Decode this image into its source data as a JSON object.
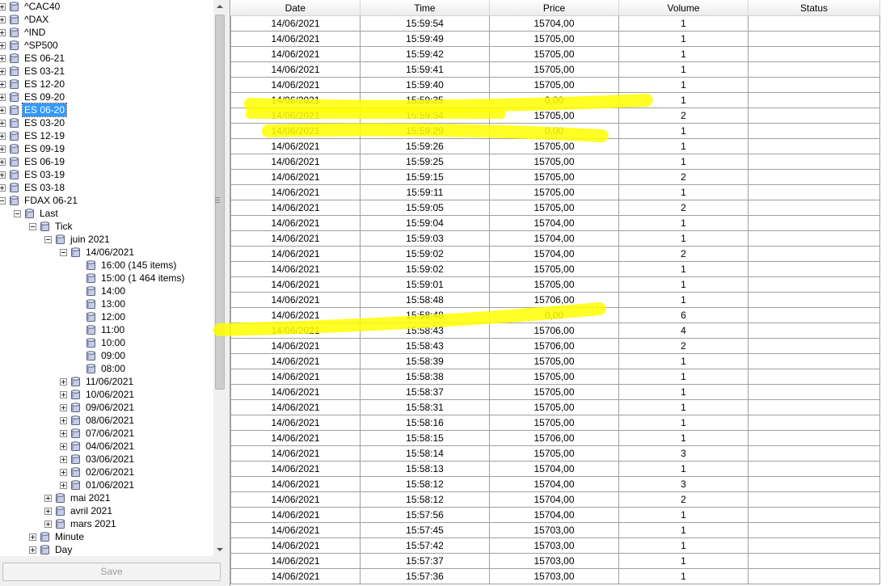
{
  "tree": {
    "nodes": [
      {
        "label": "^CAC40",
        "level": 0,
        "toggle": "plus"
      },
      {
        "label": "^DAX",
        "level": 0,
        "toggle": "plus"
      },
      {
        "label": "^IND",
        "level": 0,
        "toggle": "plus"
      },
      {
        "label": "^SP500",
        "level": 0,
        "toggle": "plus"
      },
      {
        "label": "ES 06-21",
        "level": 0,
        "toggle": "plus"
      },
      {
        "label": "ES 03-21",
        "level": 0,
        "toggle": "plus"
      },
      {
        "label": "ES 12-20",
        "level": 0,
        "toggle": "plus"
      },
      {
        "label": "ES 09-20",
        "level": 0,
        "toggle": "plus"
      },
      {
        "label": "ES 06-20",
        "level": 0,
        "toggle": "plus",
        "selected": true
      },
      {
        "label": "ES 03-20",
        "level": 0,
        "toggle": "plus"
      },
      {
        "label": "ES 12-19",
        "level": 0,
        "toggle": "plus"
      },
      {
        "label": "ES 09-19",
        "level": 0,
        "toggle": "plus"
      },
      {
        "label": "ES 06-19",
        "level": 0,
        "toggle": "plus"
      },
      {
        "label": "ES 03-19",
        "level": 0,
        "toggle": "plus"
      },
      {
        "label": "ES 03-18",
        "level": 0,
        "toggle": "plus"
      },
      {
        "label": "FDAX 06-21",
        "level": 0,
        "toggle": "minus"
      },
      {
        "label": "Last",
        "level": 1,
        "toggle": "minus"
      },
      {
        "label": "Tick",
        "level": 2,
        "toggle": "minus"
      },
      {
        "label": "juin 2021",
        "level": 3,
        "toggle": "minus"
      },
      {
        "label": "14/06/2021",
        "level": 4,
        "toggle": "minus"
      },
      {
        "label": "16:00 (145 items)",
        "level": 5,
        "toggle": "none"
      },
      {
        "label": "15:00 (1 464 items)",
        "level": 5,
        "toggle": "none"
      },
      {
        "label": "14:00",
        "level": 5,
        "toggle": "none"
      },
      {
        "label": "13:00",
        "level": 5,
        "toggle": "none"
      },
      {
        "label": "12:00",
        "level": 5,
        "toggle": "none"
      },
      {
        "label": "11:00",
        "level": 5,
        "toggle": "none"
      },
      {
        "label": "10:00",
        "level": 5,
        "toggle": "none"
      },
      {
        "label": "09:00",
        "level": 5,
        "toggle": "none"
      },
      {
        "label": "08:00",
        "level": 5,
        "toggle": "none"
      },
      {
        "label": "11/06/2021",
        "level": 4,
        "toggle": "plus"
      },
      {
        "label": "10/06/2021",
        "level": 4,
        "toggle": "plus"
      },
      {
        "label": "09/06/2021",
        "level": 4,
        "toggle": "plus"
      },
      {
        "label": "08/06/2021",
        "level": 4,
        "toggle": "plus"
      },
      {
        "label": "07/06/2021",
        "level": 4,
        "toggle": "plus"
      },
      {
        "label": "04/06/2021",
        "level": 4,
        "toggle": "plus"
      },
      {
        "label": "03/06/2021",
        "level": 4,
        "toggle": "plus"
      },
      {
        "label": "02/06/2021",
        "level": 4,
        "toggle": "plus"
      },
      {
        "label": "01/06/2021",
        "level": 4,
        "toggle": "plus"
      },
      {
        "label": "mai 2021",
        "level": 3,
        "toggle": "plus"
      },
      {
        "label": "avril 2021",
        "level": 3,
        "toggle": "plus"
      },
      {
        "label": "mars 2021",
        "level": 3,
        "toggle": "plus"
      },
      {
        "label": "Minute",
        "level": 2,
        "toggle": "plus"
      },
      {
        "label": "Day",
        "level": 2,
        "toggle": "plus"
      }
    ]
  },
  "save_label": "Save",
  "grid": {
    "columns": [
      "Date",
      "Time",
      "Price",
      "Volume",
      "Status"
    ],
    "rows": [
      [
        "14/06/2021",
        "15:59:54",
        "15704,00",
        "1",
        ""
      ],
      [
        "14/06/2021",
        "15:59:49",
        "15705,00",
        "1",
        ""
      ],
      [
        "14/06/2021",
        "15:59:42",
        "15705,00",
        "1",
        ""
      ],
      [
        "14/06/2021",
        "15:59:41",
        "15705,00",
        "1",
        ""
      ],
      [
        "14/06/2021",
        "15:59:40",
        "15705,00",
        "1",
        ""
      ],
      [
        "14/06/2021",
        "15:59:35",
        "0,00",
        "1",
        ""
      ],
      [
        "14/06/2021",
        "15:59:34",
        "15705,00",
        "2",
        ""
      ],
      [
        "14/06/2021",
        "15:59:29",
        "0,00",
        "1",
        ""
      ],
      [
        "14/06/2021",
        "15:59:26",
        "15705,00",
        "1",
        ""
      ],
      [
        "14/06/2021",
        "15:59:25",
        "15705,00",
        "1",
        ""
      ],
      [
        "14/06/2021",
        "15:59:15",
        "15705,00",
        "2",
        ""
      ],
      [
        "14/06/2021",
        "15:59:11",
        "15705,00",
        "1",
        ""
      ],
      [
        "14/06/2021",
        "15:59:05",
        "15705,00",
        "2",
        ""
      ],
      [
        "14/06/2021",
        "15:59:04",
        "15704,00",
        "1",
        ""
      ],
      [
        "14/06/2021",
        "15:59:03",
        "15704,00",
        "1",
        ""
      ],
      [
        "14/06/2021",
        "15:59:02",
        "15704,00",
        "2",
        ""
      ],
      [
        "14/06/2021",
        "15:59:02",
        "15705,00",
        "1",
        ""
      ],
      [
        "14/06/2021",
        "15:59:01",
        "15705,00",
        "1",
        ""
      ],
      [
        "14/06/2021",
        "15:58:48",
        "15706,00",
        "1",
        ""
      ],
      [
        "14/06/2021",
        "15:58:48",
        "0,00",
        "6",
        ""
      ],
      [
        "14/06/2021",
        "15:58:43",
        "15706,00",
        "4",
        ""
      ],
      [
        "14/06/2021",
        "15:58:43",
        "15706,00",
        "2",
        ""
      ],
      [
        "14/06/2021",
        "15:58:39",
        "15705,00",
        "1",
        ""
      ],
      [
        "14/06/2021",
        "15:58:38",
        "15705,00",
        "1",
        ""
      ],
      [
        "14/06/2021",
        "15:58:37",
        "15705,00",
        "1",
        ""
      ],
      [
        "14/06/2021",
        "15:58:31",
        "15705,00",
        "1",
        ""
      ],
      [
        "14/06/2021",
        "15:58:16",
        "15705,00",
        "1",
        ""
      ],
      [
        "14/06/2021",
        "15:58:15",
        "15706,00",
        "1",
        ""
      ],
      [
        "14/06/2021",
        "15:58:14",
        "15705,00",
        "3",
        ""
      ],
      [
        "14/06/2021",
        "15:58:13",
        "15704,00",
        "1",
        ""
      ],
      [
        "14/06/2021",
        "15:58:12",
        "15704,00",
        "3",
        ""
      ],
      [
        "14/06/2021",
        "15:58:12",
        "15704,00",
        "2",
        ""
      ],
      [
        "14/06/2021",
        "15:57:56",
        "15704,00",
        "1",
        ""
      ],
      [
        "14/06/2021",
        "15:57:45",
        "15703,00",
        "1",
        ""
      ],
      [
        "14/06/2021",
        "15:57:42",
        "15703,00",
        "1",
        ""
      ],
      [
        "14/06/2021",
        "15:57:37",
        "15703,00",
        "1",
        ""
      ],
      [
        "14/06/2021",
        "15:57:36",
        "15703,00",
        "1",
        ""
      ]
    ]
  },
  "colors": {
    "selection": "#3399ff",
    "highlighter": "#ffff00"
  }
}
